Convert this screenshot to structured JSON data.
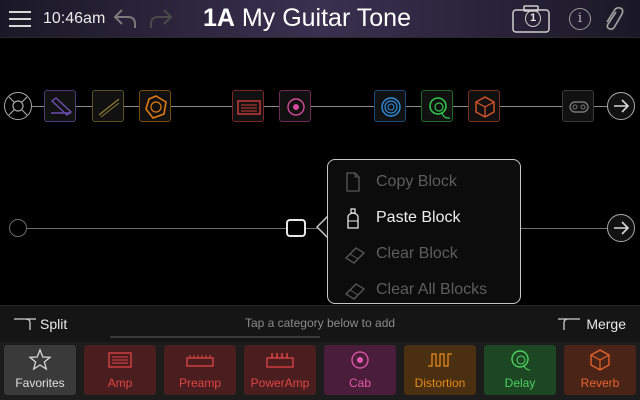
{
  "header": {
    "time": "10:46am",
    "preset_id": "1A",
    "preset_name": "My Guitar Tone",
    "snapshot_number": "1",
    "info_glyph": "i",
    "icons": [
      "menu-icon",
      "undo-icon",
      "redo-icon",
      "snapshot-camera-icon",
      "info-icon",
      "paperclip-icon"
    ]
  },
  "path_a": {
    "blocks": [
      {
        "name": "input-block",
        "icon": "input-knob-icon",
        "color": "#a8a8a8"
      },
      {
        "name": "wah-block",
        "icon": "wah-pedal-icon",
        "color": "#6b4fb0"
      },
      {
        "name": "volume-block",
        "icon": "volume-pedal-icon",
        "color": "#8a7a30"
      },
      {
        "name": "filter-block",
        "icon": "filter-icon",
        "color": "#e07a10"
      },
      {
        "name": "amp-block",
        "icon": "amp-head-icon",
        "color": "#d13b3b"
      },
      {
        "name": "cab-block",
        "icon": "speaker-icon",
        "color": "#d64a9a"
      },
      {
        "name": "modulation-block",
        "icon": "modulation-icon",
        "color": "#2f8fe0"
      },
      {
        "name": "delay-block",
        "icon": "delay-icon",
        "color": "#2fc84a"
      },
      {
        "name": "reverb-block",
        "icon": "reverb-cube-icon",
        "color": "#e0562a"
      },
      {
        "name": "looper-block",
        "icon": "looper-icon",
        "color": "#777777"
      }
    ]
  },
  "context_menu": {
    "items": [
      {
        "label": "Copy Block",
        "enabled": false,
        "icon": "copy-icon"
      },
      {
        "label": "Paste Block",
        "enabled": true,
        "icon": "paste-bottle-icon"
      },
      {
        "label": "Clear Block",
        "enabled": false,
        "icon": "eraser-icon"
      },
      {
        "label": "Clear All Blocks",
        "enabled": false,
        "icon": "eraser-icon"
      }
    ]
  },
  "split_bar": {
    "split_label": "Split",
    "hint": "Tap a category below to add",
    "merge_label": "Merge"
  },
  "categories": [
    {
      "label": "Favorites",
      "icon": "star-icon",
      "color": "#d8d8d8"
    },
    {
      "label": "Amp",
      "icon": "amp-icon",
      "color": "#e04545"
    },
    {
      "label": "Preamp",
      "icon": "preamp-icon",
      "color": "#e04545"
    },
    {
      "label": "PowerAmp",
      "icon": "poweramp-icon",
      "color": "#e04545"
    },
    {
      "label": "Cab",
      "icon": "cab-speaker-icon",
      "color": "#e35aa8"
    },
    {
      "label": "Distortion",
      "icon": "distortion-icon",
      "color": "#e58a1a"
    },
    {
      "label": "Delay",
      "icon": "delay-icon",
      "color": "#4ed064"
    },
    {
      "label": "Reverb",
      "icon": "reverb-icon",
      "color": "#e8642f"
    }
  ]
}
